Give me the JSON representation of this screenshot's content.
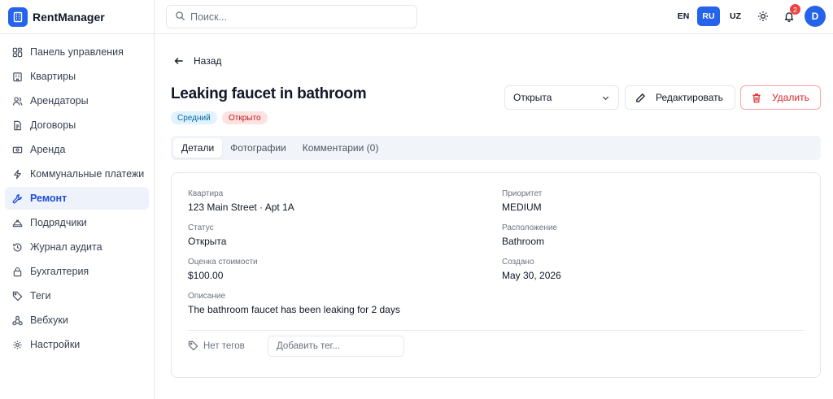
{
  "app": {
    "name": "RentManager"
  },
  "search": {
    "placeholder": "Поиск..."
  },
  "languages": [
    "EN",
    "RU",
    "UZ"
  ],
  "active_language": "RU",
  "notifications": {
    "count": "2"
  },
  "user": {
    "initial": "D"
  },
  "sidebar": {
    "items": [
      {
        "label": "Панель управления",
        "icon": "dashboard-icon"
      },
      {
        "label": "Квартиры",
        "icon": "building-icon"
      },
      {
        "label": "Арендаторы",
        "icon": "users-icon"
      },
      {
        "label": "Договоры",
        "icon": "document-icon"
      },
      {
        "label": "Аренда",
        "icon": "banknote-icon"
      },
      {
        "label": "Коммунальные платежи",
        "icon": "lightning-icon"
      },
      {
        "label": "Ремонт",
        "icon": "wrench-icon"
      },
      {
        "label": "Подрядчики",
        "icon": "hardhat-icon"
      },
      {
        "label": "Журнал аудита",
        "icon": "history-icon"
      },
      {
        "label": "Бухгалтерия",
        "icon": "lock-icon"
      },
      {
        "label": "Теги",
        "icon": "tag-icon"
      },
      {
        "label": "Вебхуки",
        "icon": "webhook-icon"
      },
      {
        "label": "Настройки",
        "icon": "gear-icon"
      }
    ],
    "active_index": 6
  },
  "page": {
    "back_label": "Назад",
    "title": "Leaking faucet in bathroom",
    "priority_badge": "Средний",
    "status_badge": "Открыто",
    "status_select": "Открыта",
    "edit_label": "Редактировать",
    "delete_label": "Удалить"
  },
  "tabs": [
    {
      "label": "Детали"
    },
    {
      "label": "Фотографии"
    },
    {
      "label": "Комментарии (0)"
    }
  ],
  "details": {
    "apartment": {
      "label": "Квартира",
      "value": "123 Main Street · Apt 1A"
    },
    "priority": {
      "label": "Приоритет",
      "value": "MEDIUM"
    },
    "status": {
      "label": "Статус",
      "value": "Открыта"
    },
    "location": {
      "label": "Расположение",
      "value": "Bathroom"
    },
    "cost": {
      "label": "Оценка стоимости",
      "value": "$100.00"
    },
    "created": {
      "label": "Создано",
      "value": "May 30, 2026"
    },
    "description": {
      "label": "Описание",
      "value": "The bathroom faucet has been leaking for 2 days"
    }
  },
  "tags": {
    "empty_label": "Нет тегов",
    "add_placeholder": "Добавить тег..."
  },
  "colors": {
    "accent": "#2563eb",
    "danger": "#dc2626"
  }
}
